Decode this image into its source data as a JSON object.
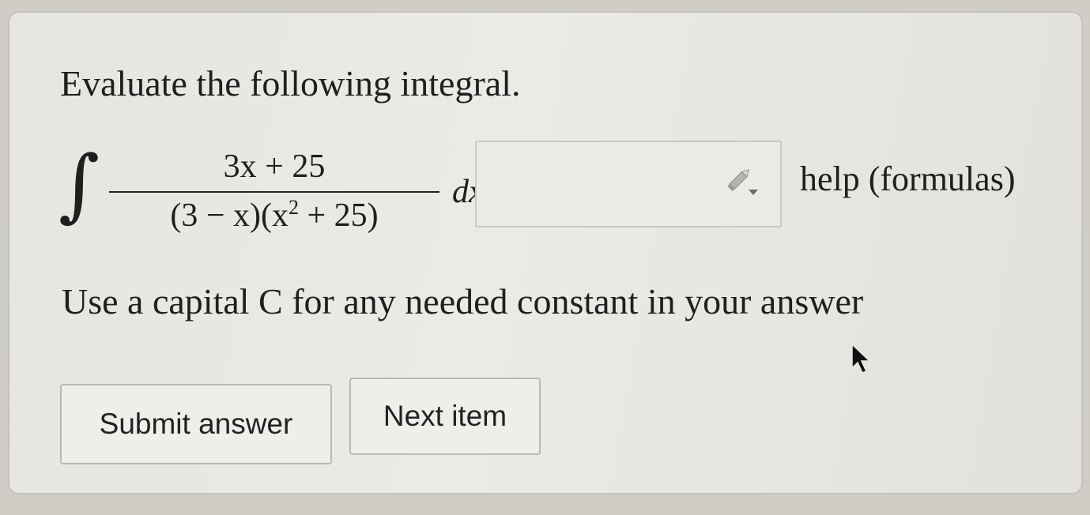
{
  "question": {
    "prompt": "Evaluate the following integral.",
    "integral_sign": "∫",
    "numerator": "3x + 25",
    "denominator_part1": "(3 − x)(x",
    "denominator_exponent": "2",
    "denominator_part2": " + 25)",
    "differential": "dx",
    "equals": "=",
    "note": "Use a capital C for any needed constant in your answer"
  },
  "answer_field": {
    "value": "",
    "icon": "pencil-dropdown-icon"
  },
  "help": {
    "label": "help (formulas)"
  },
  "buttons": {
    "submit": "Submit answer",
    "next": "Next item"
  },
  "cursor": {
    "icon": "mouse-pointer-icon"
  }
}
